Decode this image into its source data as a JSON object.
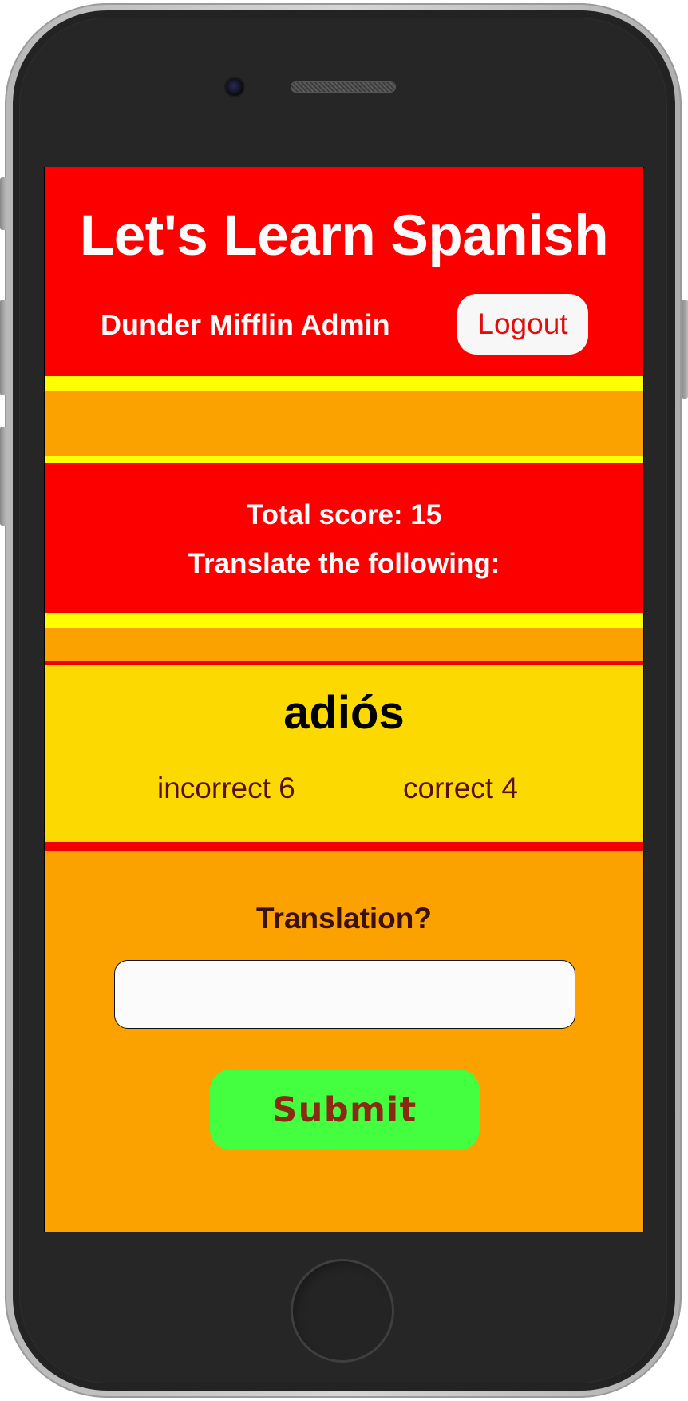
{
  "header": {
    "title": "Let's Learn Spanish",
    "user_name": "Dunder Mifflin Admin",
    "logout_label": "Logout"
  },
  "score": {
    "total_label": "Total score: 15",
    "prompt": "Translate the following:"
  },
  "word_card": {
    "word": "adiós",
    "incorrect_label": "incorrect 6",
    "correct_label": "correct 4"
  },
  "answer_form": {
    "label": "Translation?",
    "input_value": "",
    "submit_label": "Submit"
  },
  "colors": {
    "header_red": "#fc0000",
    "stripe_yellow": "#ffff00",
    "background_orange": "#fba100",
    "card_yellow": "#fcd900",
    "submit_green": "#43ff3f",
    "submit_text": "#8b2a12"
  }
}
